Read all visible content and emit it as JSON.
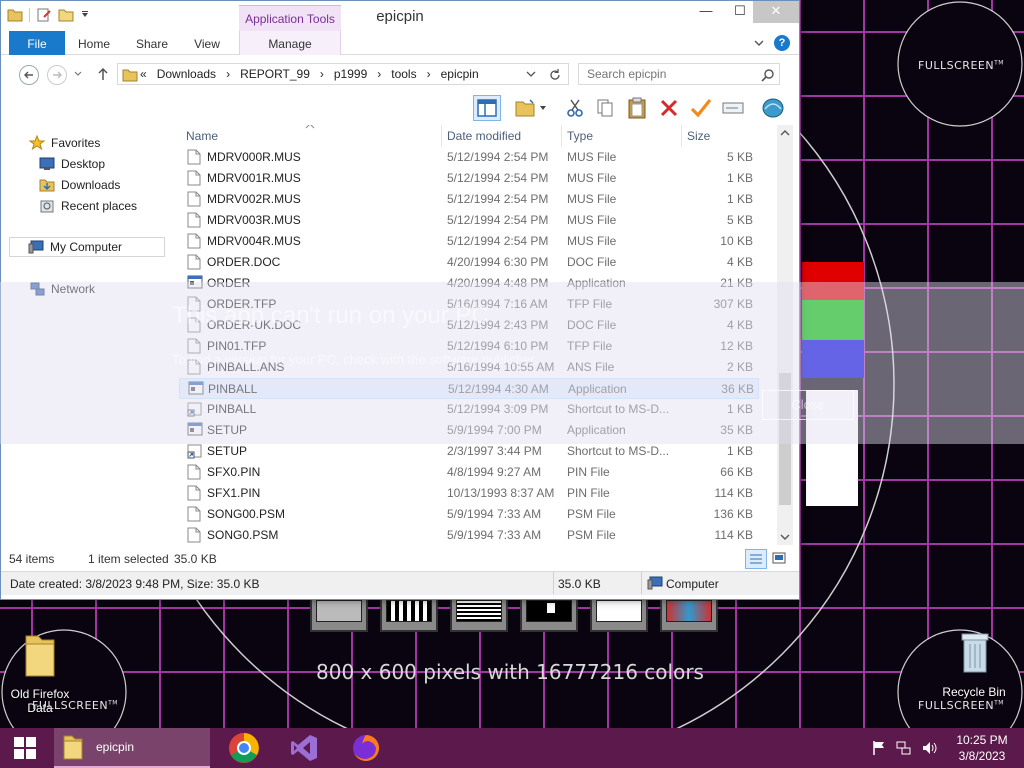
{
  "window": {
    "title": "epicpin",
    "contextual_tab_group": "Application Tools",
    "minimize_glyph": "—",
    "maximize_glyph": "☐",
    "close_glyph": "✕",
    "help_glyph": "?"
  },
  "ribbon": {
    "tabs": [
      {
        "label": "File"
      },
      {
        "label": "Home"
      },
      {
        "label": "Share"
      },
      {
        "label": "View"
      },
      {
        "label": "Manage"
      }
    ]
  },
  "address": {
    "overflow": "«",
    "crumbs": [
      "Downloads",
      "REPORT_99",
      "p1999",
      "tools",
      "epicpin"
    ],
    "search_placeholder": "Search epicpin"
  },
  "nav": {
    "items": [
      {
        "label": "Favorites",
        "icon": "star-icon"
      },
      {
        "label": "Desktop",
        "icon": "desktop-icon"
      },
      {
        "label": "Downloads",
        "icon": "downloads-folder-icon"
      },
      {
        "label": "Recent places",
        "icon": "recent-places-icon"
      },
      {
        "label": "My Computer",
        "icon": "computer-icon"
      },
      {
        "label": "Network",
        "icon": "network-icon"
      }
    ]
  },
  "columns": {
    "name": "Name",
    "date": "Date modified",
    "type": "Type",
    "size": "Size"
  },
  "files": [
    {
      "name": "MDRV000R.MUS",
      "date": "5/12/1994 2:54 PM",
      "type": "MUS File",
      "size": "5 KB",
      "icon": "file-icon"
    },
    {
      "name": "MDRV001R.MUS",
      "date": "5/12/1994 2:54 PM",
      "type": "MUS File",
      "size": "1 KB",
      "icon": "file-icon"
    },
    {
      "name": "MDRV002R.MUS",
      "date": "5/12/1994 2:54 PM",
      "type": "MUS File",
      "size": "1 KB",
      "icon": "file-icon"
    },
    {
      "name": "MDRV003R.MUS",
      "date": "5/12/1994 2:54 PM",
      "type": "MUS File",
      "size": "5 KB",
      "icon": "file-icon"
    },
    {
      "name": "MDRV004R.MUS",
      "date": "5/12/1994 2:54 PM",
      "type": "MUS File",
      "size": "10 KB",
      "icon": "file-icon"
    },
    {
      "name": "ORDER.DOC",
      "date": "4/20/1994 6:30 PM",
      "type": "DOC File",
      "size": "4 KB",
      "icon": "file-icon"
    },
    {
      "name": "ORDER",
      "date": "4/20/1994 4:48 PM",
      "type": "Application",
      "size": "21 KB",
      "icon": "application-icon"
    },
    {
      "name": "ORDER.TFP",
      "date": "5/16/1994 7:16 AM",
      "type": "TFP File",
      "size": "307 KB",
      "icon": "file-icon"
    },
    {
      "name": "ORDER-UK.DOC",
      "date": "5/12/1994 2:43 PM",
      "type": "DOC File",
      "size": "4 KB",
      "icon": "file-icon"
    },
    {
      "name": "PIN01.TFP",
      "date": "5/12/1994 6:10 PM",
      "type": "TFP File",
      "size": "12 KB",
      "icon": "file-icon"
    },
    {
      "name": "PINBALL.ANS",
      "date": "5/16/1994 10:55 AM",
      "type": "ANS File",
      "size": "2 KB",
      "icon": "file-icon"
    },
    {
      "name": "PINBALL",
      "date": "5/12/1994 4:30 AM",
      "type": "Application",
      "size": "36 KB",
      "icon": "application-icon",
      "selected": true
    },
    {
      "name": "PINBALL",
      "date": "5/12/1994 3:09 PM",
      "type": "Shortcut to MS-D...",
      "size": "1 KB",
      "icon": "shortcut-icon"
    },
    {
      "name": "SETUP",
      "date": "5/9/1994 7:00 PM",
      "type": "Application",
      "size": "35 KB",
      "icon": "application-icon"
    },
    {
      "name": "SETUP",
      "date": "2/3/1997 3:44 PM",
      "type": "Shortcut to MS-D...",
      "size": "1 KB",
      "icon": "shortcut-icon"
    },
    {
      "name": "SFX0.PIN",
      "date": "4/8/1994 9:27 AM",
      "type": "PIN File",
      "size": "66 KB",
      "icon": "file-icon"
    },
    {
      "name": "SFX1.PIN",
      "date": "10/13/1993 8:37 AM",
      "type": "PIN File",
      "size": "114 KB",
      "icon": "file-icon"
    },
    {
      "name": "SONG00.PSM",
      "date": "5/9/1994 7:33 AM",
      "type": "PSM File",
      "size": "136 KB",
      "icon": "file-icon"
    },
    {
      "name": "SONG0.PSM",
      "date": "5/9/1994 7:33 AM",
      "type": "PSM File",
      "size": "114 KB",
      "icon": "file-icon"
    }
  ],
  "status": {
    "item_count": "54 items",
    "selected": "1 item selected",
    "selected_size": "35.0 KB"
  },
  "details": {
    "info": "Date created: 3/8/2023 9:48 PM, Size: 35.0 KB",
    "size": "35.0 KB",
    "location": "Computer"
  },
  "ghost_dialog": {
    "title": "This app can't run on your PC",
    "subtitle": "To find a version for your PC, check with the software publisher.",
    "button": "Close"
  },
  "desktop": {
    "fullscreen_label": "FULLSCREEN",
    "tm": "TM",
    "resolution_text": "800 x 600 pixels with 16777216 colors",
    "icons": [
      {
        "label": "Old Firefox Data"
      },
      {
        "label": "Recycle Bin"
      }
    ]
  },
  "taskbar": {
    "explorer_label": "epicpin",
    "time": "10:25 PM",
    "date": "3/8/2023"
  },
  "colors": {
    "accent": "#1979ca",
    "taskbar": "#5c1a4c",
    "grid": "#c04ac0",
    "selection": "#e5f3ff"
  }
}
